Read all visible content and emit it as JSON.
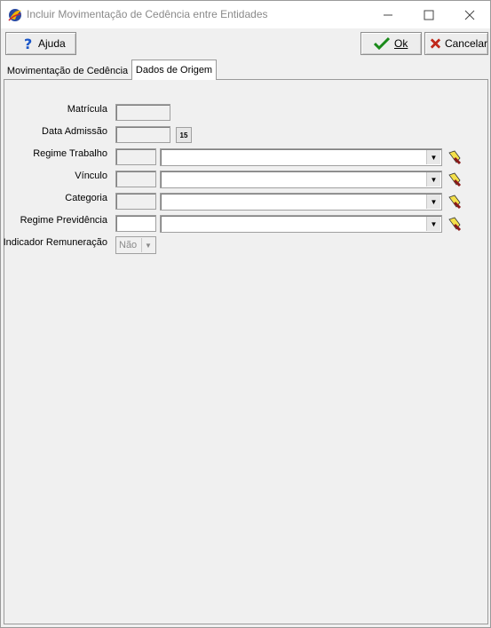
{
  "window": {
    "title": "Incluir Movimentação de Cedência entre Entidades"
  },
  "toolbar": {
    "help_label": "Ajuda",
    "ok_label": "Ok",
    "cancel_label": "Cancelar"
  },
  "tabs": [
    {
      "label": "Movimentação de Cedência",
      "active": false
    },
    {
      "label": "Dados de Origem",
      "active": true
    }
  ],
  "form": {
    "matricula": {
      "label": "Matrícula",
      "value": ""
    },
    "data_admissao": {
      "label": "Data Admissão",
      "value": "",
      "calendar_icon_text": "15"
    },
    "regime_trabalho": {
      "label": "Regime Trabalho",
      "code": "",
      "value": ""
    },
    "vinculo": {
      "label": "Vínculo",
      "code": "",
      "value": ""
    },
    "categoria": {
      "label": "Categoria",
      "code": "",
      "value": ""
    },
    "regime_previdencia": {
      "label": "Regime Previdência",
      "code": "",
      "value": ""
    },
    "indicador_remuneracao": {
      "label": "Indicador Remuneração",
      "value": "Não"
    }
  },
  "colors": {
    "ok_check": "#1a8a1a",
    "cancel_x": "#c0281a",
    "help_icon": "#1a56c8",
    "window_bg": "#f0f0f0"
  }
}
